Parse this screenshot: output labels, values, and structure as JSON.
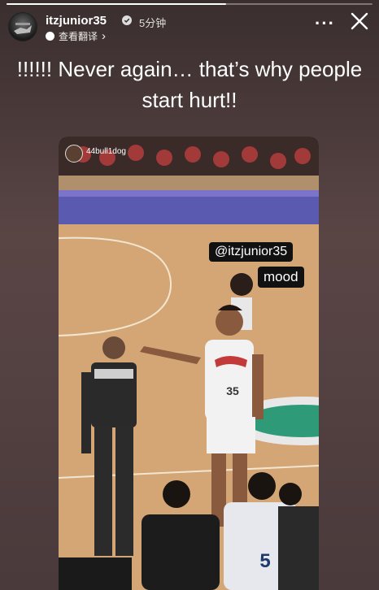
{
  "story": {
    "username": "itzjunior35",
    "time": "5分钟",
    "translate_label": "查看翻译",
    "translate_chevron": "›",
    "more_label": "···",
    "progress": 0.6,
    "caption_line1": "!!!!!! Never again… that’s why people",
    "caption_line2": "start hurt!!"
  },
  "media": {
    "repost_username": "44bull1dog",
    "sticker_mention": "@itzjunior35",
    "sticker_text": "mood",
    "jersey_number_main": "35",
    "jersey_number_front": "5"
  },
  "icons": {
    "verified": "verified-badge-icon",
    "close": "close-icon",
    "more": "more-options-icon",
    "translate": "translate-icon"
  }
}
